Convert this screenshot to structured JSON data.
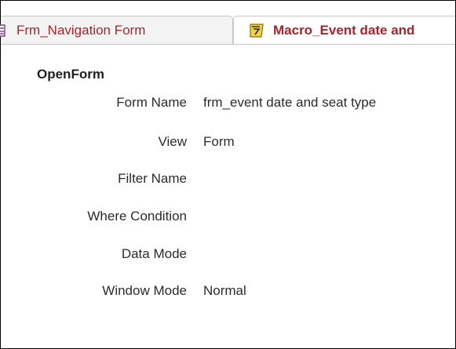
{
  "tabs": [
    {
      "label": "Frm_Navigation Form",
      "icon": "form-icon",
      "active": false
    },
    {
      "label": "Macro_Event date and",
      "icon": "macro-icon",
      "active": true
    }
  ],
  "action": {
    "title": "OpenForm",
    "arguments": [
      {
        "label": "Form Name",
        "value": "frm_event date and seat type"
      },
      {
        "label": "View",
        "value": "Form"
      },
      {
        "label": "Filter Name",
        "value": ""
      },
      {
        "label": "Where Condition",
        "value": ""
      },
      {
        "label": "Data Mode",
        "value": ""
      },
      {
        "label": "Window Mode",
        "value": "Normal"
      }
    ]
  },
  "colors": {
    "tab_text": "#a4262c",
    "tab_border": "#c6c6c6",
    "macro_icon": "#e6b800"
  }
}
